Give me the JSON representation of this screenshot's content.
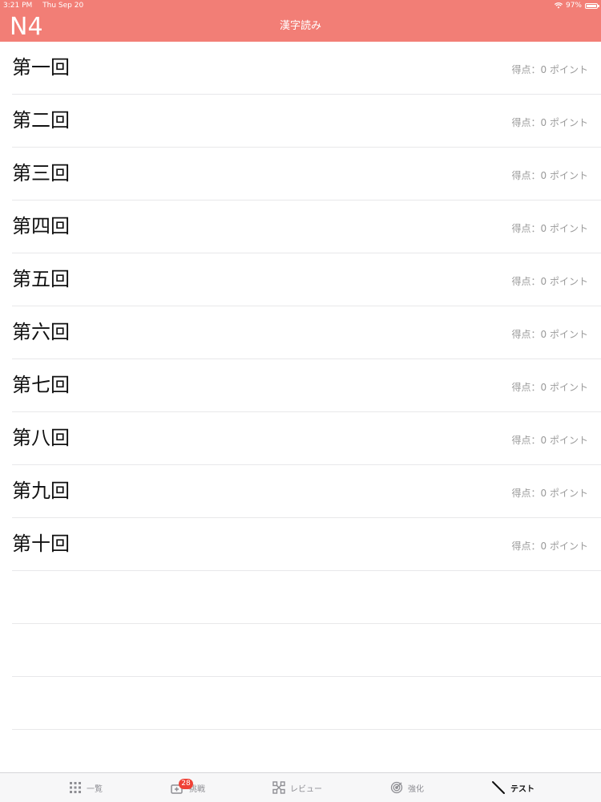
{
  "status_bar": {
    "time": "3:21 PM",
    "date": "Thu Sep 20",
    "battery": "97%",
    "battery_level": 0.97
  },
  "nav_bar": {
    "left_label": "N4",
    "title": "漢字読み"
  },
  "tests": [
    {
      "title": "第一回",
      "score": "得点：0 ポイント"
    },
    {
      "title": "第二回",
      "score": "得点：0 ポイント"
    },
    {
      "title": "第三回",
      "score": "得点：0 ポイント"
    },
    {
      "title": "第四回",
      "score": "得点：0 ポイント"
    },
    {
      "title": "第五回",
      "score": "得点：0 ポイント"
    },
    {
      "title": "第六回",
      "score": "得点：0 ポイント"
    },
    {
      "title": "第七回",
      "score": "得点：0 ポイント"
    },
    {
      "title": "第八回",
      "score": "得点：0 ポイント"
    },
    {
      "title": "第九回",
      "score": "得点：0 ポイント"
    },
    {
      "title": "第十回",
      "score": "得点：0 ポイント"
    }
  ],
  "tab_bar": {
    "tabs": [
      {
        "label": "一覧",
        "icon": "grid-icon"
      },
      {
        "label": "挑戦",
        "icon": "challenge-icon",
        "badge": "28"
      },
      {
        "label": "レビュー",
        "icon": "review-icon"
      },
      {
        "label": "強化",
        "icon": "target-icon"
      },
      {
        "label": "テスト",
        "icon": "pencil-icon",
        "active": true
      }
    ]
  },
  "colors": {
    "accent": "#f27e76",
    "badge": "#ef4136"
  }
}
